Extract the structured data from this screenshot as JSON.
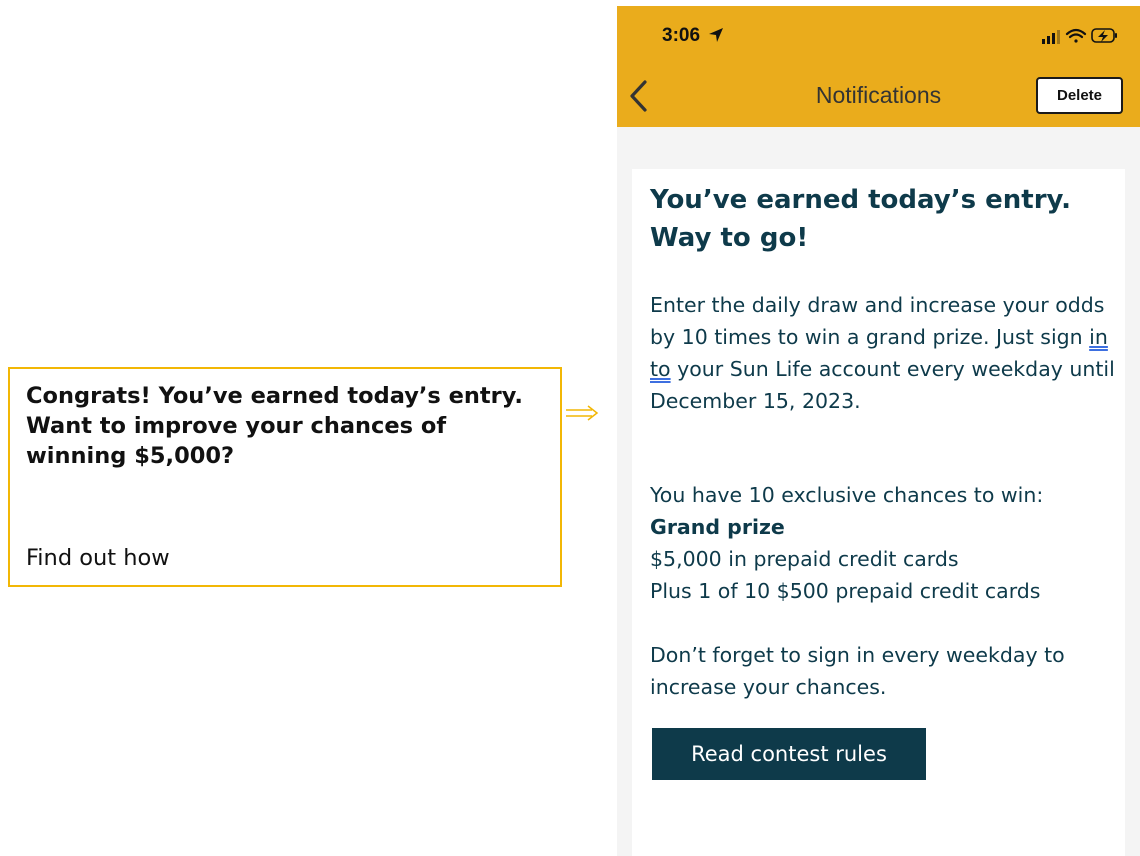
{
  "annotation": {
    "title": "Congrats! You’ve earned today’s entry. Want to improve your chances of winning $5,000?",
    "link": "Find out how",
    "border_color": "#f2b705"
  },
  "status_bar": {
    "time": "3:06",
    "icons": [
      "location-arrow-icon",
      "signal-icon",
      "wifi-icon",
      "battery-charging-icon"
    ]
  },
  "nav": {
    "back_icon": "chevron-left-icon",
    "title": "Notifications",
    "delete_label": "Delete",
    "header_color": "#eaac1c"
  },
  "notification": {
    "title": "You’ve earned today’s entry. Way to go!",
    "para1_before": "Enter the daily draw and increase your odds by 10 times to win a grand prize. Just sign ",
    "para1_link": "in to",
    "para1_after": " your Sun Life account every weekday until December 15, 2023.",
    "para2_line1": "You have 10 exclusive chances to win:",
    "para2_bold": "Grand prize",
    "para2_line3": "$5,000 in prepaid credit cards",
    "para2_line4": "Plus 1 of 10 $500 prepaid credit cards",
    "para3": "Don’t forget to sign in every weekday to increase your chances.",
    "button_label": "Read contest rules",
    "text_color": "#0e3a4a"
  }
}
